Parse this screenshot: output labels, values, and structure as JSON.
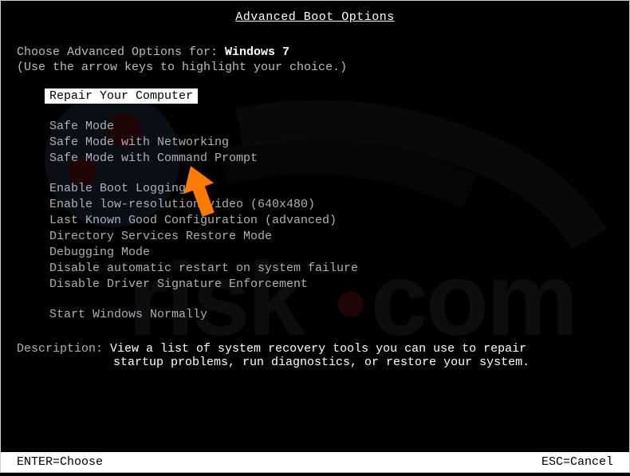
{
  "title": "Advanced Boot Options",
  "instruction_prefix": "Choose Advanced Options for: ",
  "os_name": "Windows 7",
  "hint": "(Use the arrow keys to highlight your choice.)",
  "menu": {
    "selected": "Repair Your Computer",
    "group1": [
      "Safe Mode",
      "Safe Mode with Networking",
      "Safe Mode with Command Prompt"
    ],
    "group2": [
      "Enable Boot Logging",
      "Enable low-resolution video (640x480)",
      "Last Known Good Configuration (advanced)",
      "Directory Services Restore Mode",
      "Debugging Mode",
      "Disable automatic restart on system failure",
      "Disable Driver Signature Enforcement"
    ],
    "group3": [
      "Start Windows Normally"
    ]
  },
  "description": {
    "label": "Description: ",
    "text_line1": "View a list of system recovery tools you can use to repair",
    "text_line2": "startup problems, run diagnostics, or restore your system."
  },
  "footer": {
    "enter": "ENTER=Choose",
    "esc": "ESC=Cancel"
  },
  "watermark": {
    "text": "pcrisk.com"
  },
  "arrow": {
    "color": "#ff7a00"
  }
}
